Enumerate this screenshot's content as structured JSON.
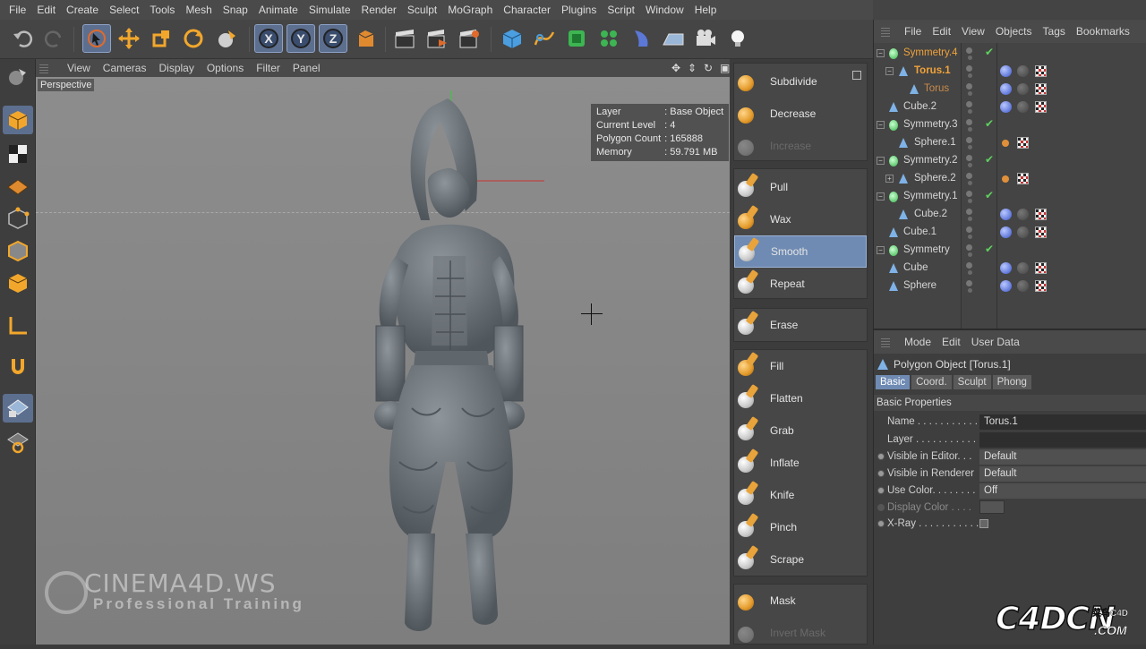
{
  "menubar": [
    "File",
    "Edit",
    "Create",
    "Select",
    "Tools",
    "Mesh",
    "Snap",
    "Animate",
    "Simulate",
    "Render",
    "Sculpt",
    "MoGraph",
    "Character",
    "Plugins",
    "Script",
    "Window",
    "Help"
  ],
  "toolbar": {
    "icons": [
      "undo-icon",
      "redo-icon",
      "live-selection-icon",
      "move-icon",
      "scale-icon",
      "rotate-icon",
      "recent-tool-icon",
      "x-axis-lock-icon",
      "y-axis-lock-icon",
      "z-axis-lock-icon",
      "world-coordinates-icon",
      "render-view-icon",
      "render-picture-viewer-icon",
      "edit-render-settings-icon",
      "cube-primitive-icon",
      "spline-icon",
      "nurbs-icon",
      "array-icon",
      "deformer-icon",
      "floor-icon",
      "camera-icon",
      "light-icon"
    ],
    "axis_labels": [
      "X",
      "Y",
      "Z"
    ]
  },
  "leftbar": [
    "make-editable-icon",
    "model-mode-icon",
    "texture-mode-icon",
    "workplane-icon",
    "points-mode-icon",
    "edges-mode-icon",
    "polygons-mode-icon",
    "axis-mode-icon",
    "magnet-icon",
    "locked-workplane-icon",
    "snap-settings-icon"
  ],
  "viewport": {
    "menu": [
      "View",
      "Cameras",
      "Display",
      "Options",
      "Filter",
      "Panel"
    ],
    "view_name": "Perspective",
    "hud": [
      {
        "key": "Layer",
        "value": ": Base Object"
      },
      {
        "key": "Current Level",
        "value": ": 4"
      },
      {
        "key": "Polygon Count",
        "value": ": 165888"
      },
      {
        "key": "Memory",
        "value": ": 59.791 MB"
      }
    ],
    "watermark_line1": "CINEMA4D.WS",
    "watermark_line2": "Professional  Training"
  },
  "sculpt": {
    "group1": [
      {
        "label": "Subdivide",
        "disabled": false
      },
      {
        "label": "Decrease",
        "disabled": false
      },
      {
        "label": "Increase",
        "disabled": true
      }
    ],
    "group2": [
      {
        "label": "Pull",
        "selected": false
      },
      {
        "label": "Wax",
        "selected": false
      },
      {
        "label": "Smooth",
        "selected": true
      },
      {
        "label": "Repeat",
        "selected": false
      }
    ],
    "group3": [
      {
        "label": "Erase"
      }
    ],
    "group4": [
      {
        "label": "Fill"
      },
      {
        "label": "Flatten"
      },
      {
        "label": "Grab"
      },
      {
        "label": "Inflate"
      },
      {
        "label": "Knife"
      },
      {
        "label": "Pinch"
      },
      {
        "label": "Scrape"
      }
    ],
    "group5": [
      {
        "label": "Mask",
        "disabled": false
      },
      {
        "label": "Invert Mask",
        "disabled": true
      }
    ]
  },
  "objmgr": {
    "menu": [
      "File",
      "Edit",
      "View",
      "Objects",
      "Tags",
      "Bookmarks"
    ],
    "rows": [
      {
        "name": "Symmetry.4",
        "style": "hl",
        "type": "sym",
        "indent": 0
      },
      {
        "name": "Torus.1",
        "style": "hl",
        "type": "tri",
        "indent": 1
      },
      {
        "name": "Torus",
        "style": "hl2",
        "type": "tri",
        "indent": 2
      },
      {
        "name": "Cube.2",
        "style": "",
        "type": "tri",
        "indent": 0
      },
      {
        "name": "Symmetry.3",
        "style": "",
        "type": "sym",
        "indent": 0
      },
      {
        "name": "Sphere.1",
        "style": "",
        "type": "tri",
        "indent": 1
      },
      {
        "name": "Symmetry.2",
        "style": "",
        "type": "sym",
        "indent": 0
      },
      {
        "name": "Sphere.2",
        "style": "",
        "type": "tri",
        "indent": 1
      },
      {
        "name": "Symmetry.1",
        "style": "",
        "type": "sym",
        "indent": 0
      },
      {
        "name": "Cube.2",
        "style": "",
        "type": "tri",
        "indent": 1
      },
      {
        "name": "Cube.1",
        "style": "",
        "type": "tri",
        "indent": 0
      },
      {
        "name": "Symmetry",
        "style": "",
        "type": "sym",
        "indent": 0
      },
      {
        "name": "Cube",
        "style": "",
        "type": "tri",
        "indent": 0
      },
      {
        "name": "Sphere",
        "style": "",
        "type": "tri",
        "indent": 0
      }
    ]
  },
  "attrmgr": {
    "menu": [
      "Mode",
      "Edit",
      "User Data"
    ],
    "object_title": "Polygon Object [Torus.1]",
    "tabs": [
      "Basic",
      "Coord.",
      "Sculpt",
      "Phong"
    ],
    "section": "Basic Properties",
    "name_label": "Name . . . . . . . . . . . .",
    "name_value": "Torus.1",
    "layer_label": "Layer . . . . . . . . . . . .",
    "vis_editor_label": "Visible in Editor. . .",
    "vis_editor_value": "Default",
    "vis_render_label": "Visible in Renderer",
    "vis_render_value": "Default",
    "use_color_label": "Use Color. . . . . . . .",
    "use_color_value": "Off",
    "display_color_label": "Display Color . . . .",
    "xray_label": "X-Ray . . . . . . . . . . ."
  },
  "corner_logo": {
    "big": "C4DCN",
    "small": "菜鸟C4D",
    "sub": ".COM"
  },
  "colors": {
    "accent": "#6f8bb3",
    "orange": "#f0a23a",
    "green": "#37b34a"
  }
}
